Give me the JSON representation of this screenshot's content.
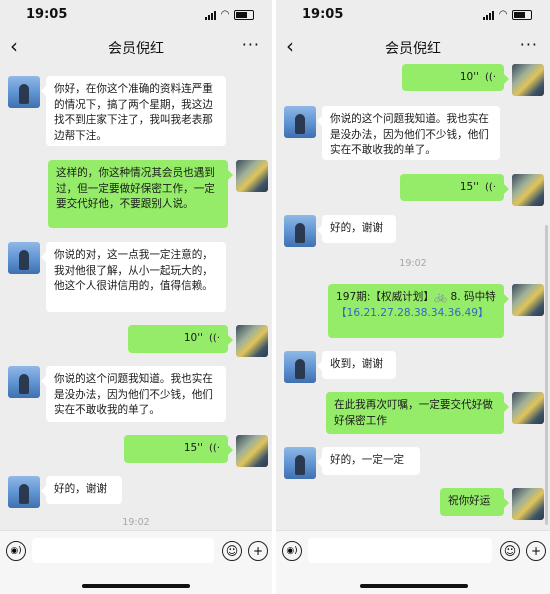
{
  "status": {
    "time": "19:05"
  },
  "header": {
    "title": "会员倪红",
    "back_glyph": "‹",
    "more_glyph": "···"
  },
  "left": {
    "messages": [
      {
        "from": "in",
        "text": "你好，在你这个准确的资料连严重的情况下，搞了两个星期，我这边找不到庄家下注了，我叫我老表那边帮下注。"
      },
      {
        "from": "out",
        "text": "这样的，你这种情况其会员也遇到过，但一定要做好保密工作，一定要交代好他，不要跟别人说。"
      },
      {
        "from": "in",
        "text": "你说的对，这一点我一定注意的，我对他很了解，从小一起玩大的，他这个人很讲信用的，值得信赖。"
      },
      {
        "from": "out",
        "voice": "10''"
      },
      {
        "from": "in",
        "text": "你说的这个问题我知道。我也实在是没办法，因为他们不少钱，他们实在不敢收我的单了。"
      },
      {
        "from": "out",
        "voice": "15''"
      },
      {
        "from": "in",
        "text": "好的，谢谢"
      }
    ],
    "timestamp": "19:02"
  },
  "right": {
    "messages": [
      {
        "from": "out",
        "voice": "10''"
      },
      {
        "from": "in",
        "text": "你说的这个问题我知道。我也实在是没办法，因为他们不少钱，他们实在不敢收我的单了。"
      },
      {
        "from": "out",
        "voice": "15''"
      },
      {
        "from": "in",
        "text": "好的，谢谢"
      },
      {
        "from": "out",
        "lot_prefix": "197期:【权威计划】",
        "lot_mid": "🚲 8. 码中特",
        "lot_numbers": "【16.21.27.28.38.34.36.49】"
      },
      {
        "from": "in",
        "text": "收到，谢谢"
      },
      {
        "from": "out",
        "text": "在此我再次叮嘱，一定要交代好做好保密工作"
      },
      {
        "from": "in",
        "text": "好的，一定一定"
      },
      {
        "from": "out",
        "text": "祝你好运"
      }
    ],
    "timestamp": "19:02"
  },
  "icons": {
    "voice_wave": "((·",
    "voice_input": "◉)",
    "emoji": "☺",
    "plus": "+"
  },
  "colors": {
    "out_bubble": "#95ec69",
    "in_bubble": "#ffffff",
    "background": "#ededed"
  }
}
